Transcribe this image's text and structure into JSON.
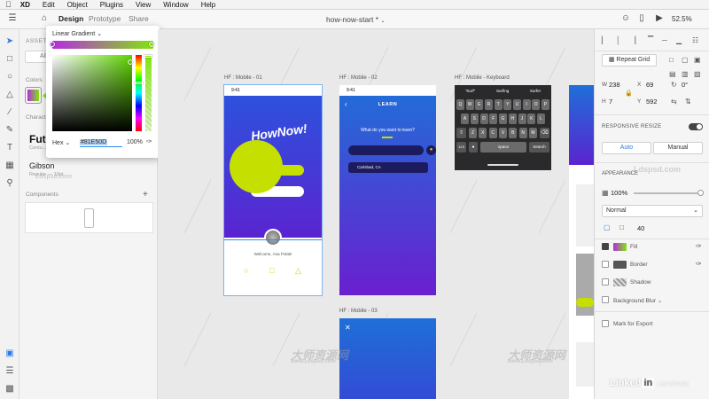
{
  "menubar": {
    "app": "XD",
    "items": [
      "Edit",
      "Object",
      "Plugins",
      "View",
      "Window",
      "Help"
    ]
  },
  "toolbar": {
    "tabs": [
      "Design",
      "Prototype",
      "Share"
    ],
    "doc_title": "how-now-start *",
    "zoom": "52.5%"
  },
  "assets": {
    "title": "ASSETS",
    "search_placeholder": "All A",
    "colors_label": "Colors",
    "character_label": "Characte",
    "char_big": "Futu",
    "char_big_meta": "Centu...",
    "char_name": "Gibson",
    "char_name_meta": "Regular — 13pt",
    "components_label": "Components"
  },
  "picker": {
    "type": "Linear Gradient",
    "mode": "Hex",
    "hex": "#81E50D",
    "opacity": "100%",
    "gradient_start": "#b72be0",
    "gradient_end": "#81e50d"
  },
  "artboards": {
    "a1": {
      "label": "HF : Mobile - 01",
      "time": "9:41",
      "logo": "HowNow!",
      "welcome": "Welcome, Ana Polak!"
    },
    "a2": {
      "label": "HF : Mobile - 02",
      "time": "9:41",
      "header": "LEARN",
      "question": "What do you want to learn?",
      "location": "Carlsbad, CA"
    },
    "a3": {
      "label": "HF : Mobile - Keyboard",
      "suggestions": [
        "\"Surf\"",
        "Surfing",
        "Surfer"
      ],
      "row1": [
        "Q",
        "W",
        "E",
        "R",
        "T",
        "Y",
        "U",
        "I",
        "O",
        "P"
      ],
      "row2": [
        "A",
        "S",
        "D",
        "F",
        "G",
        "H",
        "J",
        "K",
        "L"
      ],
      "row3": [
        "Z",
        "X",
        "C",
        "V",
        "B",
        "N",
        "M"
      ],
      "num_key": "123",
      "space_key": "space",
      "search_key": "Search"
    },
    "a4": {
      "label": "HF : Mobile - 03"
    }
  },
  "inspector": {
    "repeat_grid": "Repeat Grid",
    "w_label": "W",
    "w": "238",
    "x_label": "X",
    "x": "69",
    "rotation": "0°",
    "h_label": "H",
    "h": "7",
    "y_label": "Y",
    "y": "592",
    "responsive": "RESPONSIVE RESIZE",
    "auto": "Auto",
    "manual": "Manual",
    "appearance": "APPEARANCE",
    "opacity": "100%",
    "blend": "Normal",
    "radius": "40",
    "fill": "Fill",
    "border": "Border",
    "shadow": "Shadow",
    "bg_blur": "Background Blur",
    "export": "Mark for Export"
  },
  "watermark": {
    "site": "Ldspsd.com",
    "site_logo": "Ldspsd.com",
    "cn": "大师资源网",
    "sub": "www.Ldspsd.com"
  },
  "branding": {
    "linked": "Linked",
    "in": "in",
    "learning": "LEARNING"
  },
  "colors": {
    "brand_purple": "#6a1fd0",
    "brand_blue": "#1f6fd8",
    "accent_green": "#c5e000"
  }
}
